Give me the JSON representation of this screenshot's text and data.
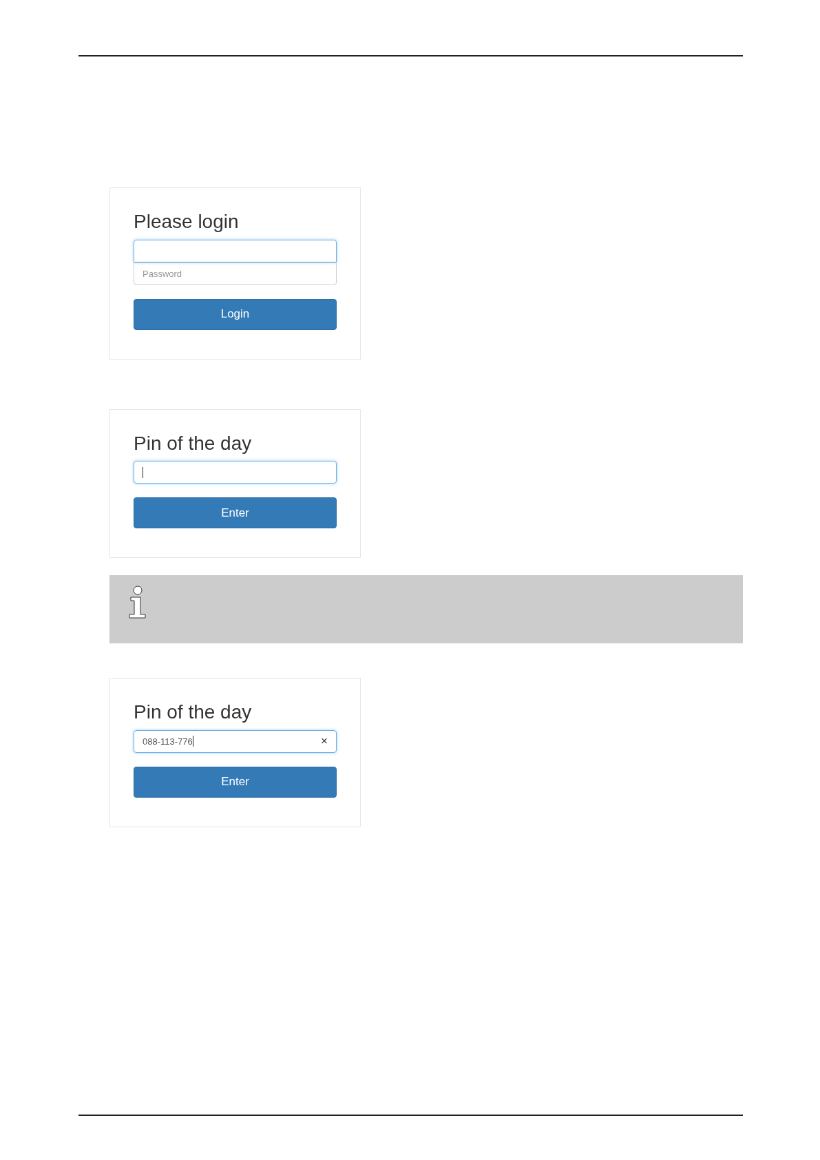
{
  "cards": [
    {
      "kind": "login",
      "title": "Please login",
      "fields": [
        {
          "focused": true,
          "caret": false
        },
        {
          "placeholder": "Password",
          "focused": false,
          "caret": false
        }
      ],
      "button": "Login"
    },
    {
      "kind": "pin",
      "title": "Pin of the day",
      "fields": [
        {
          "focused": true,
          "caret": true
        }
      ],
      "button": "Enter"
    },
    {
      "kind": "note"
    },
    {
      "kind": "pin",
      "title": "Pin of the day",
      "fields": [
        {
          "value": "088-113-776",
          "focused": true,
          "caret": true,
          "clear": "×"
        }
      ],
      "button": "Enter"
    }
  ]
}
